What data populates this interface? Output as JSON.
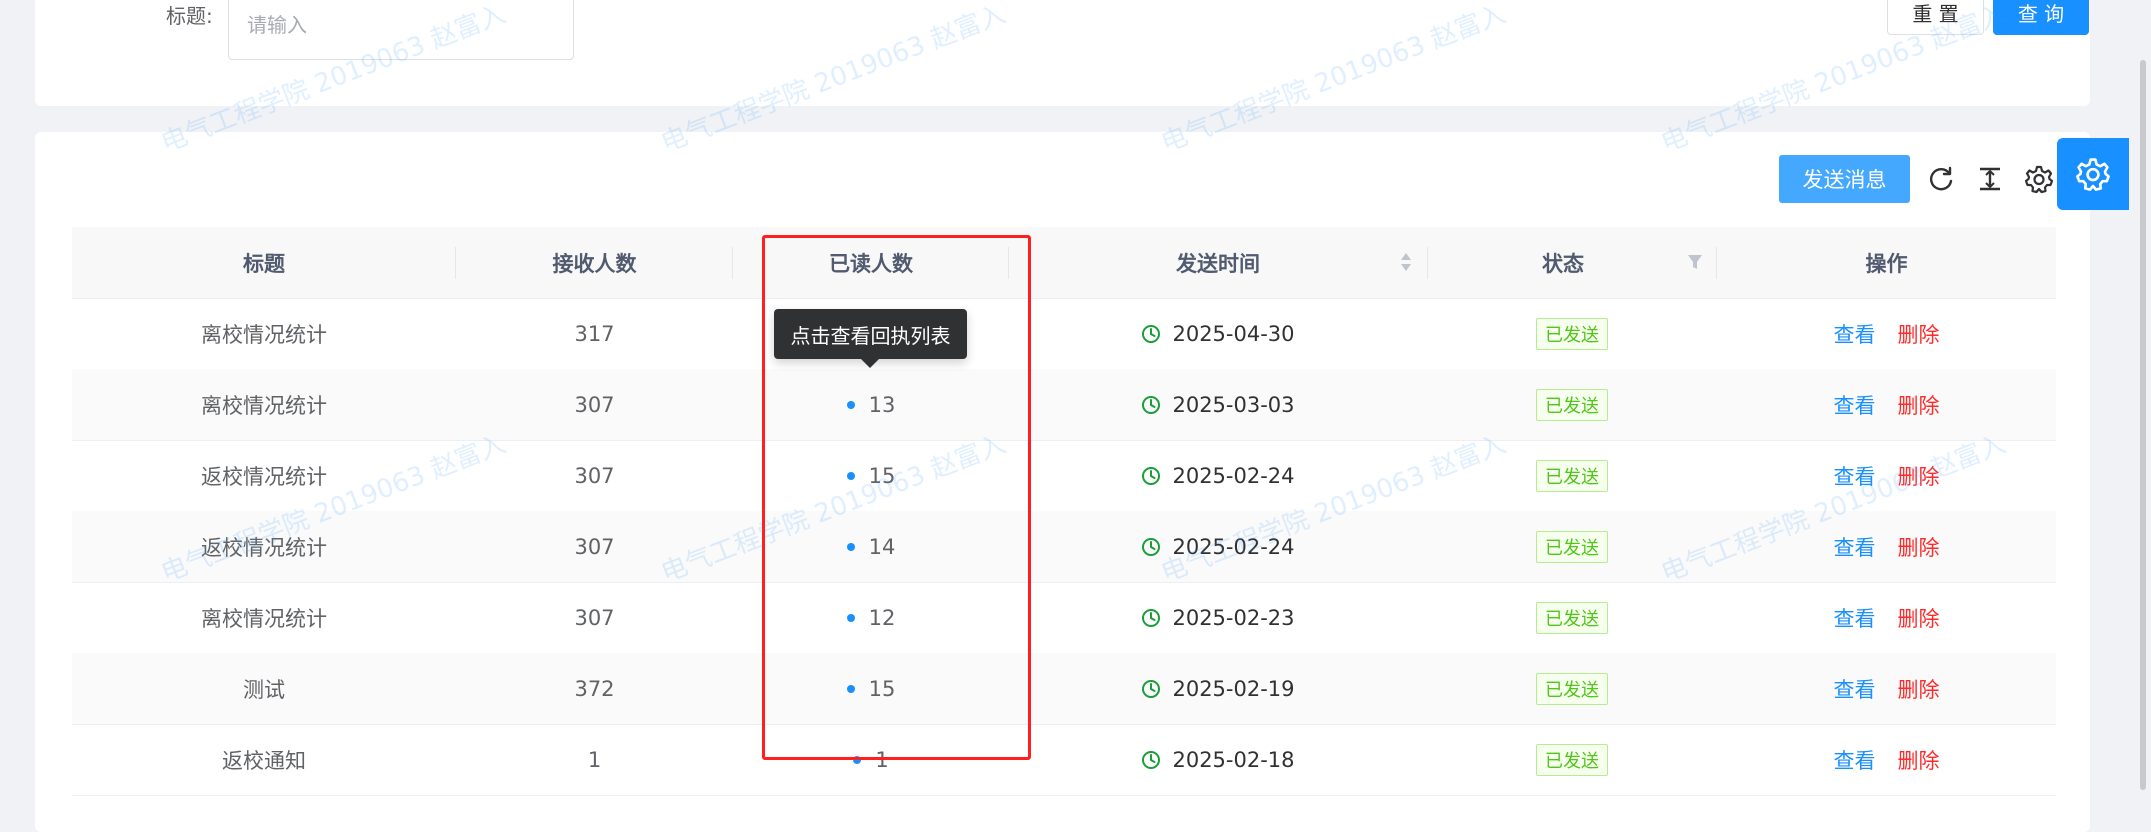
{
  "search": {
    "title_label": "标题:",
    "title_placeholder": "请输入",
    "reset_label": "重 置",
    "query_label": "查 询"
  },
  "toolbar": {
    "send_label": "发送消息",
    "refresh_icon": "refresh-icon",
    "density_icon": "column-height-icon",
    "settings_icon": "gear-icon"
  },
  "floating": {
    "icon": "gear-icon"
  },
  "watermark": "电气工程学院 2019063 赵富入",
  "table": {
    "headers": [
      "标题",
      "接收人数",
      "已读人数",
      "发送时间",
      "状态",
      "操作"
    ],
    "rows": [
      {
        "title": "离校情况统计",
        "recipients": "317",
        "read": "",
        "time": "2025-04-30",
        "status": "已发送"
      },
      {
        "title": "离校情况统计",
        "recipients": "307",
        "read": "13",
        "time": "2025-03-03",
        "status": "已发送"
      },
      {
        "title": "返校情况统计",
        "recipients": "307",
        "read": "15",
        "time": "2025-02-24",
        "status": "已发送"
      },
      {
        "title": "返校情况统计",
        "recipients": "307",
        "read": "14",
        "time": "2025-02-24",
        "status": "已发送"
      },
      {
        "title": "离校情况统计",
        "recipients": "307",
        "read": "12",
        "time": "2025-02-23",
        "status": "已发送"
      },
      {
        "title": "测试",
        "recipients": "372",
        "read": "15",
        "time": "2025-02-19",
        "status": "已发送"
      },
      {
        "title": "返校通知",
        "recipients": "1",
        "read": "1",
        "time": "2025-02-18",
        "status": "已发送"
      }
    ],
    "action_view": "查看",
    "action_delete": "删除"
  },
  "tooltip": "点击查看回执列表",
  "colors": {
    "primary": "#1890ff",
    "danger": "#ff2b2b",
    "success": "#52c41a",
    "highlight": "#ff1f1f"
  }
}
